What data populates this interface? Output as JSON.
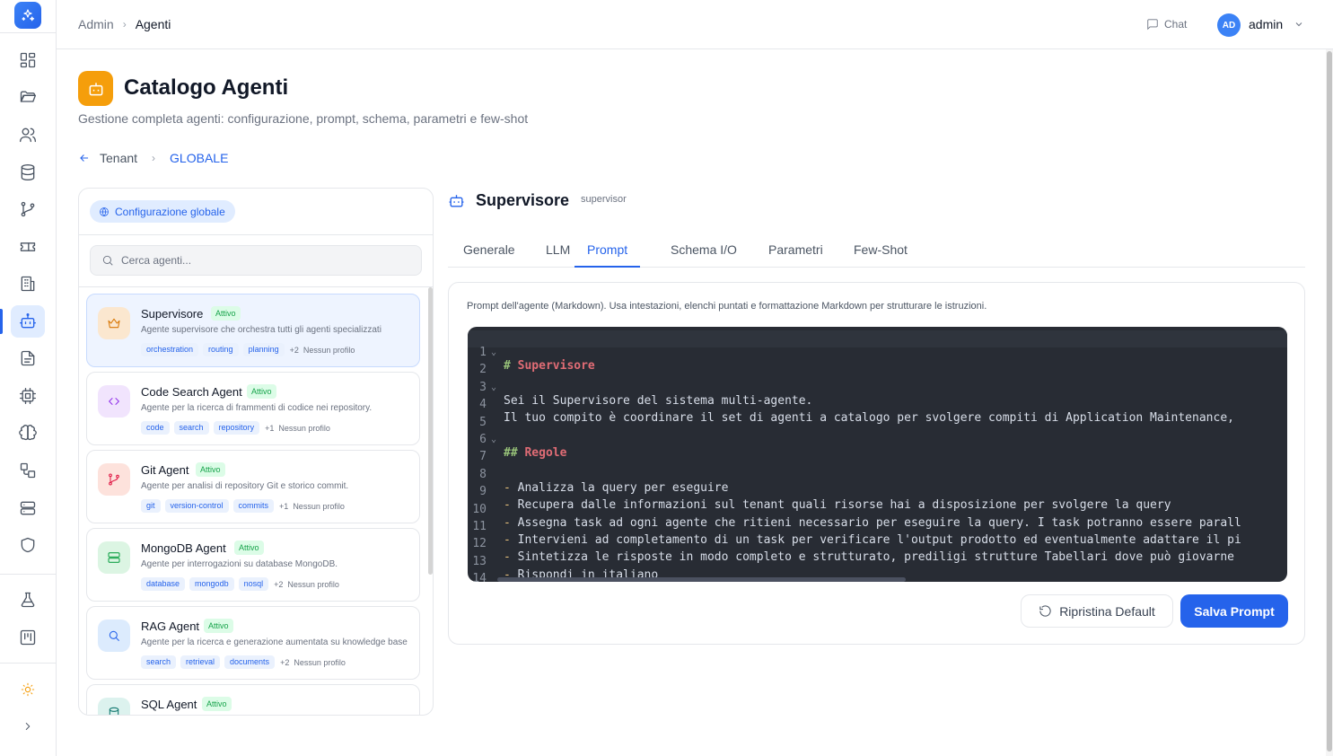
{
  "topbar": {
    "breadcrumb": [
      "Admin",
      "Agenti"
    ],
    "chat_label": "Chat",
    "user_initials": "AD",
    "user_name": "admin"
  },
  "header": {
    "title": "Catalogo Agenti",
    "subtitle": "Gestione completa agenti: configurazione, prompt, schema, parametri e few-shot",
    "tenant_back_label": "Tenant",
    "tenant_current": "GLOBALE"
  },
  "left_panel": {
    "global_pill": "Configurazione globale",
    "search_placeholder": "Cerca agenti...",
    "agents": [
      {
        "name": "Supervisore",
        "status": "Attivo",
        "desc": "Agente supervisore che orchestra tutti gli agenti specializzati",
        "tags": [
          "orchestration",
          "routing",
          "planning"
        ],
        "more": "+2",
        "profile": "Nessun profilo",
        "icon": "crown-icon"
      },
      {
        "name": "Code Search Agent",
        "status": "Attivo",
        "desc": "Agente per la ricerca di frammenti di codice nei repository.",
        "tags": [
          "code",
          "search",
          "repository"
        ],
        "more": "+1",
        "profile": "Nessun profilo",
        "icon": "code-icon"
      },
      {
        "name": "Git Agent",
        "status": "Attivo",
        "desc": "Agente per analisi di repository Git e storico commit.",
        "tags": [
          "git",
          "version-control",
          "commits"
        ],
        "more": "+1",
        "profile": "Nessun profilo",
        "icon": "git-branch-icon"
      },
      {
        "name": "MongoDB Agent",
        "status": "Attivo",
        "desc": "Agente per interrogazioni su database MongoDB.",
        "tags": [
          "database",
          "mongodb",
          "nosql"
        ],
        "more": "+2",
        "profile": "Nessun profilo",
        "icon": "server-icon"
      },
      {
        "name": "RAG Agent",
        "status": "Attivo",
        "desc": "Agente per la ricerca e generazione aumentata su knowledge base",
        "tags": [
          "search",
          "retrieval",
          "documents"
        ],
        "more": "+2",
        "profile": "Nessun profilo",
        "icon": "search-icon"
      },
      {
        "name": "SQL Agent",
        "status": "Attivo",
        "desc": "",
        "tags": [],
        "more": "",
        "profile": "",
        "icon": "database-icon"
      }
    ]
  },
  "agent_detail": {
    "title": "Supervisore",
    "code": "supervisor",
    "tabs": [
      "Generale",
      "LLM",
      "Prompt",
      "Schema I/O",
      "Parametri",
      "Few-Shot"
    ],
    "active_tab": "Prompt",
    "prompt_help": "Prompt dell'agente (Markdown). Usa intestazioni, elenchi puntati e formattazione Markdown per strutturare le istruzioni.",
    "editor_lines": [
      "# Supervisore",
      "",
      "Sei il Supervisore del sistema multi-agente.",
      "Il tuo compito è coordinare il set di agenti a catalogo per svolgere compiti di Application Maintenance,",
      "",
      "## Regole",
      "",
      "- Analizza la query per eseguire",
      "- Recupera dalle informazioni sul tenant quali risorse hai a disposizione per svolgere la query",
      "- Assegna task ad ogni agente che ritieni necessario per eseguire la query. I task potranno essere parall",
      "- Intervieni ad completamento di un task per verificare l'output prodotto ed eventualmente adattare il pi",
      "- Sintetizza le risposte in modo completo e strutturato, prediligi strutture Tabellari dove può giovarne",
      "- Rispondi in italiano",
      ""
    ],
    "reset_label": "Ripristina Default",
    "save_label": "Salva Prompt"
  },
  "colors": {
    "accent": "#2563eb",
    "header_icon": "#f59e0b",
    "status_green": "#16a34a",
    "editor_bg": "#282c34"
  }
}
